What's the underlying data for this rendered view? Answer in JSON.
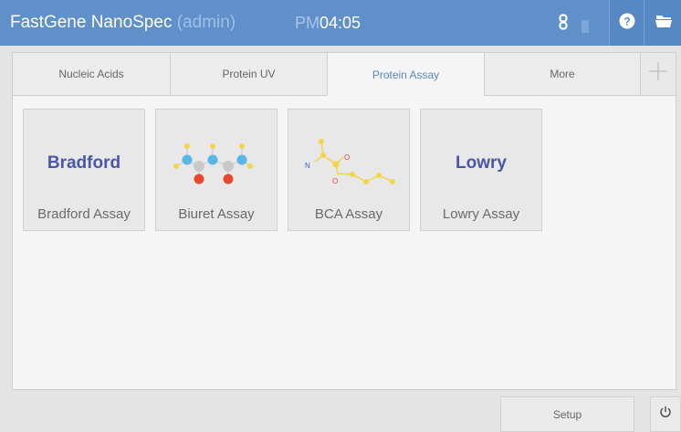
{
  "header": {
    "app_name": "FastGene NanoSpec",
    "user": "(admin)",
    "clock_ampm": "PM",
    "clock_time": "04:05",
    "icons": [
      "link-icon",
      "battery-icon",
      "help-icon",
      "folder-icon"
    ]
  },
  "tabs": [
    {
      "label": "Nucleic Acids",
      "active": false
    },
    {
      "label": "Protein UV",
      "active": false
    },
    {
      "label": "Protein Assay",
      "active": true
    },
    {
      "label": "More",
      "active": false
    }
  ],
  "tab_add_icon": "plus-icon",
  "tiles": [
    {
      "title": "Bradford",
      "label": "Bradford Assay"
    },
    {
      "title": "",
      "label": "Biuret Assay",
      "icon": "molecule-icon"
    },
    {
      "title": "",
      "label": "BCA Assay",
      "icon": "molecule-icon"
    },
    {
      "title": "Lowry",
      "label": "Lowry Assay"
    }
  ],
  "bca_atoms": [
    "N",
    "O",
    "O"
  ],
  "footer": {
    "setup_label": "Setup",
    "power_icon": "power-icon"
  },
  "colors": {
    "header_bg": "#5f90c9",
    "accent": "#5b85c2",
    "tile_title": "#4a56a8"
  }
}
